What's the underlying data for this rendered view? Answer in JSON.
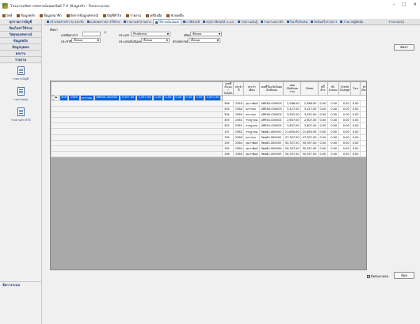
{
  "window": {
    "title": "โปรแกรมจัดการสหกรณ์ออมทรัพย์ 7.0 (ข้อมูลจริง - ปีงบประมาณ)",
    "controls": [
      "–",
      "□",
      "✕"
    ]
  },
  "menu": [
    "ไฟล์",
    "ข้อมูลหลัก",
    "ข้อมูลสมาชิก",
    "จัดการข้อมูลสหกรณ์",
    "บัญชีทั่วไป",
    "รายงาน",
    "เครื่องมือ",
    "ช่วยเหลือ"
  ],
  "sidebar": {
    "header1": "ทุกรายการบัญชี",
    "header2": "จัดเก็บค่าใช้จ่าย",
    "header3": "วัสดุของสหกรณ์",
    "header4": "ข้อมูลหลัก",
    "header5": "ข้อมูลบุคคล",
    "header6": "ผลงาน",
    "header7": "รายงาน",
    "items": [
      {
        "label": "รายการบัญชี"
      },
      {
        "label": "รายงานสรุป"
      },
      {
        "label": "รายงานประจำปี"
      }
    ],
    "footer": "จัดการระบบ"
  },
  "tabs": [
    "สร้างบิลค่าบริการ/ สมาชิก",
    "แสดงผลรายการใช้จ่าย",
    "รายงานค่าส่วนต่าง",
    "ใช้จ่ายเงินปันผล",
    "ภาษีเงินได้",
    "สรุปภาษีเงินได้ ภ.ง.ด.",
    "รายงานเงินกู้",
    "รายงานสมาชิก",
    "ใบเสร็จรับเงิน",
    "จัดพิมพ์ใบรายการ",
    "รายงานผู้ถือหุ้น"
  ],
  "active_tab_index": 3,
  "right_link": "รายงานสรุป",
  "filters": {
    "group_label": "ค้นหา",
    "doc_label": "เลขที่เอกสาร",
    "doc_value": "",
    "type_label": "ประเภท",
    "type_value": "Phathana",
    "month_label": "เดือน",
    "month_value": "ทั้งหมด",
    "year_label": "ประจำปี",
    "year_value": "ทั้งหมด",
    "status_label": "ประเภทเงินปันผล",
    "status_value": "ทั้งหมด",
    "branch_label": "ฝ่ายสหกรณ์",
    "branch_value": "ทั้งหมด",
    "search_button": "ค้นหา"
  },
  "table": {
    "columns": [
      "เลขที่ตัวเอง / ปัจจุบัน",
      "ประจำปี",
      "ประจำเดือน",
      "เลขที่ใบแจ้งปันผลเงินปันผล",
      "ยอดเงินปันผลรวม",
      "เงินสด",
      "หนี้ค้าง",
      "หักส่วนลด",
      "Credit Charge",
      "โอน",
      "ค่าจ่ายเงินปันผล",
      "รวม"
    ],
    "rows": [
      [
        "308",
        "2560",
        "มกราคม",
        "ARR00-000002",
        "3,557.00",
        "3,557.00",
        "0.00",
        "0.00",
        "0.00",
        "0.00",
        "0.00",
        "3,557.00"
      ],
      [
        "306",
        "2559",
        "กุมภาพันธ์",
        "ARR00-000003",
        "2,586.00",
        "2,586.00",
        "0.00",
        "0.00",
        "0.00",
        "0.00",
        "0.00",
        "2,586.00"
      ],
      [
        "305",
        "2560",
        "มกราคม",
        "ARR00-000003",
        "3,427.00",
        "3,427.00",
        "0.00",
        "0.00",
        "0.00",
        "0.00",
        "0.00",
        "3,427.00"
      ],
      [
        "304",
        "2560",
        "มกราคม",
        "ARR00-000002",
        "3,552.00",
        "3,552.00",
        "0.00",
        "0.00",
        "0.00",
        "0.00",
        "0.00",
        "3,552.00"
      ],
      [
        "303",
        "2561",
        "กรกฎาคม",
        "ARR01-000001",
        "2,607.00",
        "2,607.00",
        "0.00",
        "0.00",
        "0.00",
        "0.00",
        "0.00",
        "2,607.00"
      ],
      [
        "302",
        "2561",
        "กรกฎาคม",
        "ARR01-000001",
        "3,607.00",
        "3,607.00",
        "0.00",
        "0.00",
        "0.00",
        "0.00",
        "0.00",
        "3,607.00"
      ],
      [
        "157",
        "2561",
        "กรกฎาคม",
        "Rep62-000001",
        "21,850.00",
        "21,850.00",
        "0.00",
        "0.00",
        "0.00",
        "0.00",
        "0.00",
        "21,850.00"
      ],
      [
        "159",
        "2560",
        "มกราคม",
        "Rep62-000002",
        "47,307.00",
        "47,307.00",
        "0.00",
        "0.00",
        "0.00",
        "0.00",
        "0.00",
        "47,307.00"
      ],
      [
        "155",
        "2560",
        "กุมภาพันธ์",
        "Rep62-000003",
        "50,357.00",
        "50,357.00",
        "0.00",
        "0.00",
        "0.00",
        "0.00",
        "0.00",
        "50,357.00"
      ],
      [
        "155",
        "2560",
        "กุมภาพันธ์",
        "Rep62-000004",
        "50,357.00",
        "50,357.00",
        "0.00",
        "0.00",
        "0.00",
        "0.00",
        "0.00",
        "50,357.00"
      ],
      [
        "156",
        "2560",
        "กุมภาพันธ์",
        "Rep62-000005",
        "50,357.00",
        "50,357.00",
        "0.00",
        "0.00",
        "0.00",
        "0.00",
        "0.00",
        "50,357.00"
      ]
    ],
    "selected_row": 0
  },
  "footer": {
    "checkbox_label": "พิมพ์แนวนอน",
    "checkbox_checked": true,
    "print_button": "พิมพ์"
  }
}
